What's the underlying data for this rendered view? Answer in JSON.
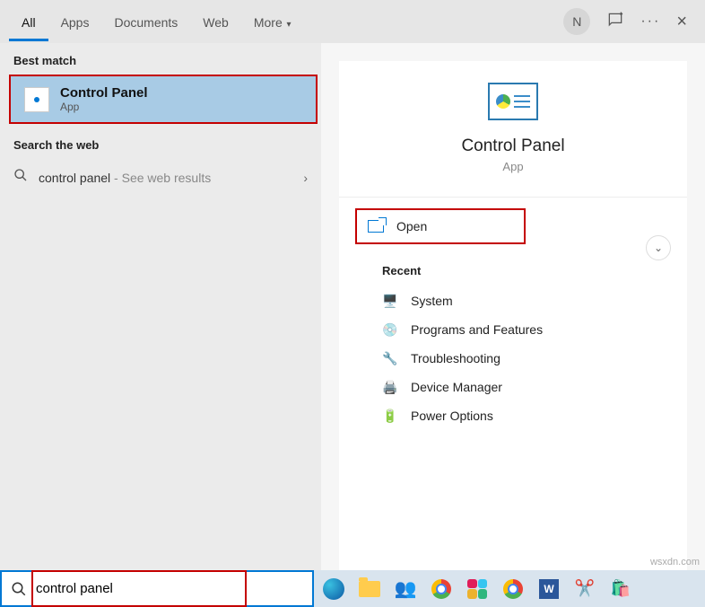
{
  "tabs": {
    "all": "All",
    "apps": "Apps",
    "documents": "Documents",
    "web": "Web",
    "more": "More"
  },
  "top": {
    "avatar_letter": "N",
    "dots": "···",
    "close": "×"
  },
  "left": {
    "best_match_label": "Best match",
    "best_match_item": {
      "title": "Control Panel",
      "subtitle": "App"
    },
    "search_web_label": "Search the web",
    "web_row": {
      "term": "control panel",
      "suffix": " - See web results"
    }
  },
  "right": {
    "title": "Control Panel",
    "subtitle": "App",
    "open_label": "Open",
    "recent_label": "Recent",
    "recent_items": [
      "System",
      "Programs and Features",
      "Troubleshooting",
      "Device Manager",
      "Power Options"
    ]
  },
  "search": {
    "value": "control panel"
  },
  "watermark": "wsxdn.com"
}
